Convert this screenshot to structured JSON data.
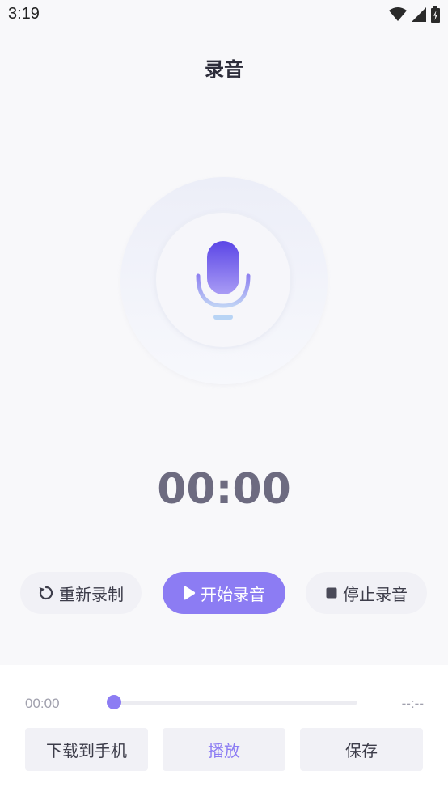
{
  "status_bar": {
    "time": "3:19"
  },
  "header": {
    "title": "录音"
  },
  "timer": {
    "display": "00:00"
  },
  "controls": {
    "rerecord_label": "重新录制",
    "start_label": "开始录音",
    "stop_label": "停止录音"
  },
  "player": {
    "current_time": "00:00",
    "total_time": "--:--",
    "progress": 0
  },
  "actions": {
    "download_label": "下载到手机",
    "play_label": "播放",
    "save_label": "保存"
  },
  "colors": {
    "accent": "#8c7cf3",
    "background": "#f8f8fa"
  },
  "icons": [
    "wifi-icon",
    "signal-icon",
    "battery-icon",
    "microphone-icon",
    "refresh-icon",
    "play-icon",
    "stop-icon"
  ]
}
